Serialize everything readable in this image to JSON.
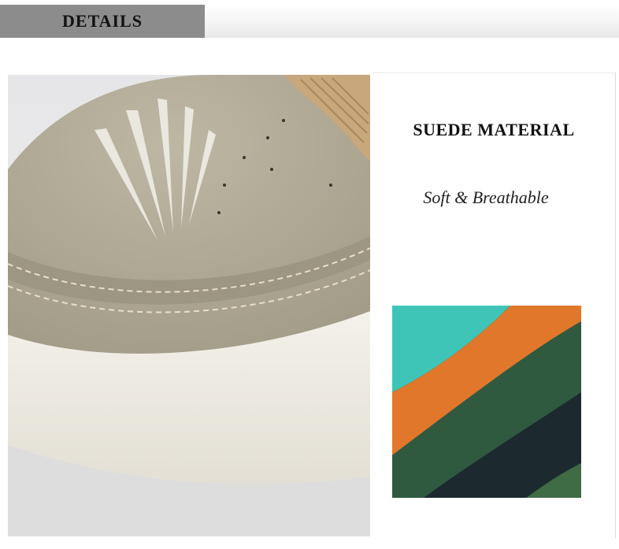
{
  "header": {
    "title": "DETAILS"
  },
  "feature": {
    "title": "SUEDE MATERIAL",
    "subtitle": "Soft & Breathable"
  },
  "colors": {
    "header_tab": "#8c8c8c",
    "suede": "#b4ae9b",
    "sole": "#efebe3",
    "elastic": "#c8a77d",
    "swatch_teal": "#3ec5b8",
    "swatch_orange": "#e0772a",
    "swatch_green": "#2f5a40",
    "swatch_navy": "#1e2a33"
  }
}
